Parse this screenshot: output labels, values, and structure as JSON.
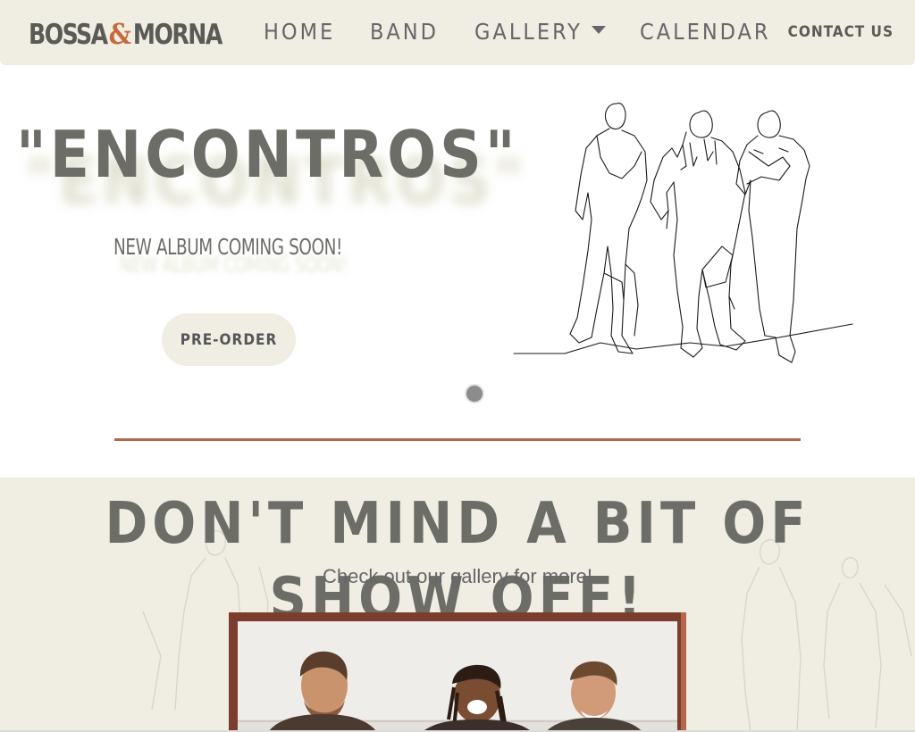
{
  "nav": {
    "logo_left": "BOSSA",
    "logo_amp": "&",
    "logo_right": "MORNA",
    "items": [
      {
        "label": "HOME"
      },
      {
        "label": "BAND"
      },
      {
        "label": "GALLERY"
      },
      {
        "label": "CALENDAR"
      }
    ],
    "contact_label": "CONTACT US"
  },
  "hero": {
    "title": "\"ENCONTROS\"",
    "subtitle": "NEW ALBUM COMING SOON!",
    "button_label": "PRE-ORDER",
    "carousel_slides": 1,
    "carousel_active": 1
  },
  "gallery_teaser": {
    "title": "DON'T MIND A BIT OF SHOW OFF!",
    "subtitle": "Check out our gallery for more!"
  },
  "colors": {
    "nav_bg": "#f0ede3",
    "accent": "#b4674a",
    "frame": "#7b3e2e",
    "text": "#6d6d68"
  }
}
